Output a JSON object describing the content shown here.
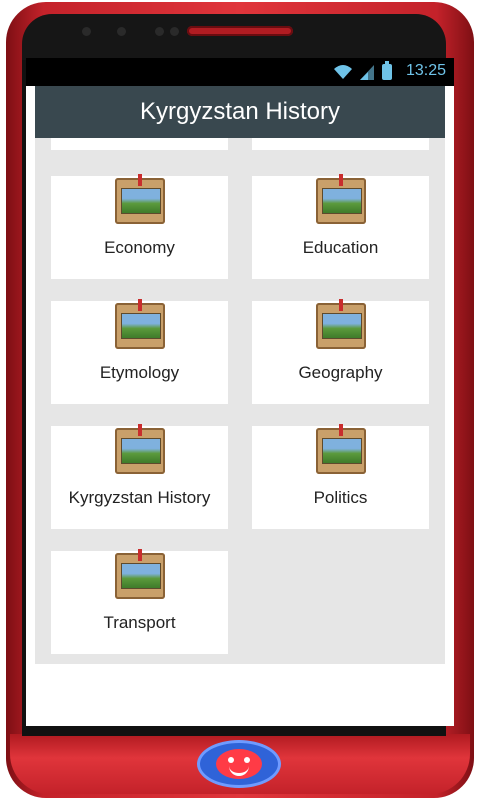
{
  "status_bar": {
    "time": "13:25",
    "icons": [
      "wifi-icon",
      "signal-icon",
      "battery-icon"
    ],
    "time_color": "#6fc3e8"
  },
  "app_bar": {
    "title": "Kyrgyzstan History",
    "background": "#39484f"
  },
  "grid": {
    "items": [
      {
        "label": "Economy",
        "icon": "book-icon"
      },
      {
        "label": "Education",
        "icon": "book-icon"
      },
      {
        "label": "Etymology",
        "icon": "book-icon"
      },
      {
        "label": "Geography",
        "icon": "book-icon"
      },
      {
        "label": "Kyrgyzstan History",
        "icon": "book-icon"
      },
      {
        "label": "Politics",
        "icon": "book-icon"
      },
      {
        "label": "Transport",
        "icon": "book-icon"
      }
    ]
  },
  "device": {
    "frame_color": "#e0353b",
    "home_button_color": "#2f63d8"
  }
}
